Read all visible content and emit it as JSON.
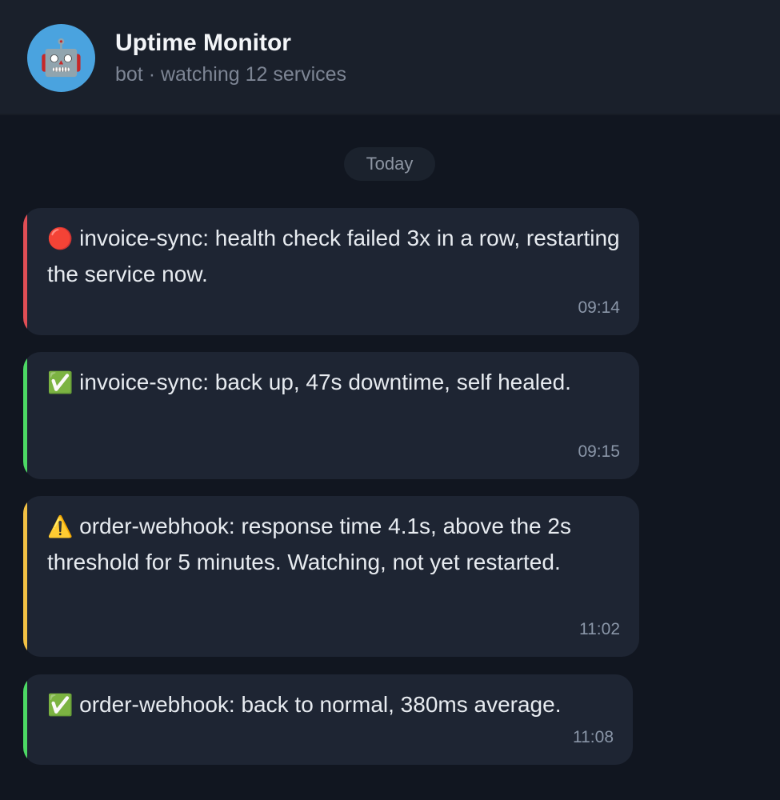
{
  "header": {
    "avatar_emoji": "🤖",
    "title": "Uptime Monitor",
    "subtitle": "bot · watching 12 services"
  },
  "divider": {
    "label": "Today"
  },
  "messages": [
    {
      "emoji": "🔴",
      "text": "invoice-sync: health check failed 3x in a row, restarting the service now.",
      "time": "09:14",
      "accent": "#e04e55",
      "icon": "red-circle-icon"
    },
    {
      "emoji": "✅",
      "text": "invoice-sync: back up, 47s downtime, self healed.",
      "time": "09:15",
      "accent": "#4cd964",
      "icon": "check-mark-icon"
    },
    {
      "emoji": "⚠️",
      "text": "order-webhook: response time 4.1s, above the 2s threshold for 5 minutes. Watching, not yet restarted.",
      "time": "11:02",
      "accent": "#f2c144",
      "icon": "warning-icon"
    },
    {
      "emoji": "✅",
      "text": "order-webhook: back to normal, 380ms average.",
      "time": "11:08",
      "accent": "#4cd964",
      "icon": "check-mark-icon"
    }
  ]
}
